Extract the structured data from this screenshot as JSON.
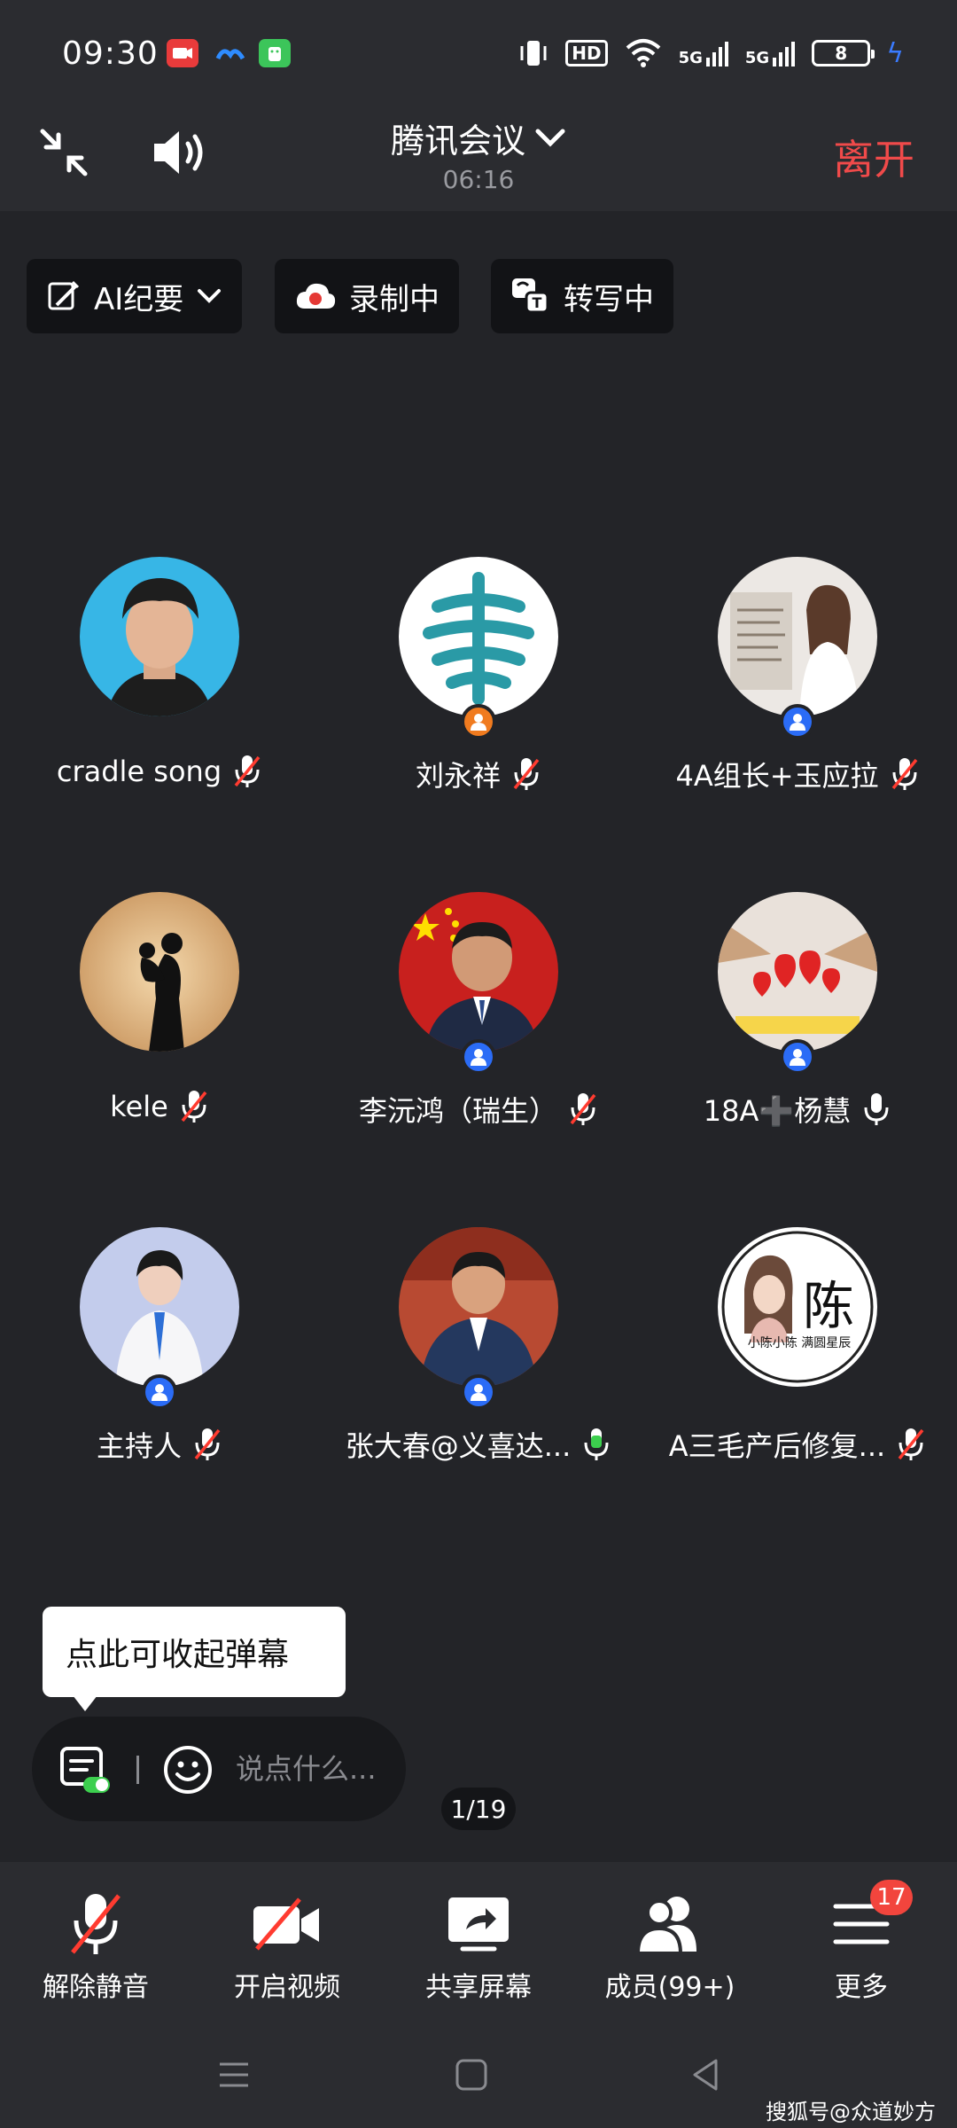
{
  "status_bar": {
    "time": "09:30",
    "hd_label": "HD",
    "signal_1": "5G",
    "signal_2": "5G",
    "battery": "8",
    "icons": [
      "video-app-icon",
      "cloud-app-icon",
      "android-app-icon",
      "vibrate-icon",
      "wifi-icon",
      "cellular-signal-icon",
      "charging-icon"
    ]
  },
  "header": {
    "meeting_title": "腾讯会议",
    "timer": "06:16",
    "leave_label": "离开"
  },
  "chips": {
    "ai_summary": "AI纪要",
    "recording": "录制中",
    "transcribing": "转写中"
  },
  "participants": [
    {
      "name": "cradle song",
      "mic": "muted",
      "badge": "none"
    },
    {
      "name": "刘永祥",
      "mic": "muted",
      "badge": "host"
    },
    {
      "name": "4A组长+玉应拉",
      "mic": "muted",
      "badge": "co-host"
    },
    {
      "name": "kele",
      "mic": "muted",
      "badge": "none"
    },
    {
      "name": "李沅鸿（瑞生）",
      "mic": "muted",
      "badge": "co-host"
    },
    {
      "name": "18A➕杨慧",
      "mic": "on",
      "badge": "co-host"
    },
    {
      "name": "主持人",
      "mic": "muted",
      "badge": "co-host"
    },
    {
      "name": "张大春@义喜达...",
      "mic": "speaking",
      "badge": "co-host"
    },
    {
      "name": "A三毛产后修复...",
      "mic": "muted",
      "badge": "none"
    }
  ],
  "avatar_text": {
    "chen_char": "陈",
    "chen_caption": "小陈小陈 满圆星辰"
  },
  "danmaku": {
    "tip": "点此可收起弹幕",
    "placeholder": "说点什么..."
  },
  "page_indicator": "1/19",
  "toolbar": {
    "unmute": "解除静音",
    "start_video": "开启视频",
    "share_screen": "共享屏幕",
    "members": "成员(99+)",
    "more": "更多",
    "more_badge": "17"
  },
  "watermark": "搜狐号@众道妙方",
  "colors": {
    "background": "#232428",
    "leave": "#f04a4a",
    "badge_blue": "#2b6cf6",
    "host_orange": "#f07b1f",
    "speaking_green": "#3ccf4e"
  }
}
